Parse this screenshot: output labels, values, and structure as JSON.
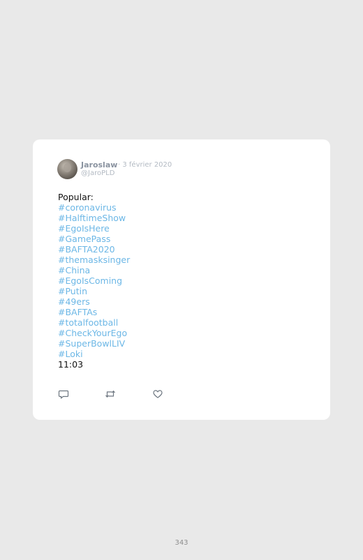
{
  "tweet": {
    "author_name": "Jaroslaw",
    "date": "· 3 février 2020",
    "handle": "@JaroPLD",
    "intro": "Popular:",
    "hashtags": [
      "#coronavirus",
      "#HalftimeShow",
      "#EgoIsHere",
      "#GamePass",
      "#BAFTA2020",
      "#themasksinger",
      "#China",
      "#EgoIsComing",
      "#Putin",
      "#49ers",
      "#BAFTAs",
      "#totalfootball",
      "#CheckYourEgo",
      "#SuperBowlLIV",
      "#Loki"
    ],
    "time": "11:03",
    "actions": {
      "reply_icon": "reply-icon",
      "retweet_icon": "retweet-icon",
      "like_icon": "heart-icon"
    }
  },
  "colors": {
    "background": "#e9e9e9",
    "card": "#ffffff",
    "hashtag": "#6cb7e6",
    "muted": "#b3bac3"
  },
  "page_number": "343"
}
